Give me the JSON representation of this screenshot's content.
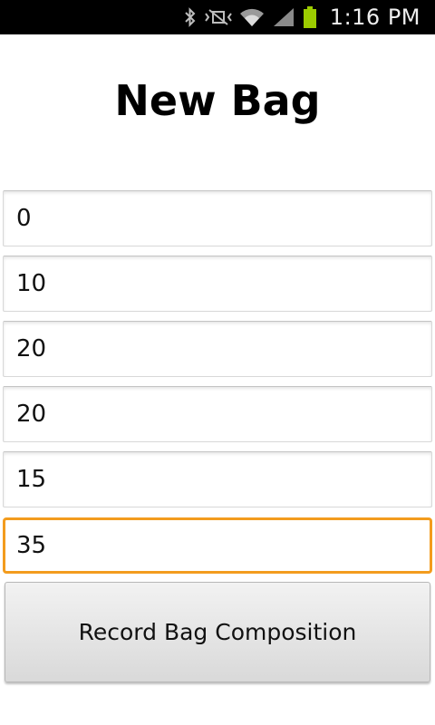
{
  "status_bar": {
    "time": "1:16 PM",
    "icons": [
      "bluetooth-icon",
      "mute-vibrate-icon",
      "wifi-icon",
      "cell-signal-icon",
      "battery-icon"
    ],
    "battery_color": "#9ccc00"
  },
  "screen": {
    "title": "New Bag"
  },
  "fields": [
    {
      "value": "0"
    },
    {
      "value": "10"
    },
    {
      "value": "20"
    },
    {
      "value": "20"
    },
    {
      "value": "15"
    },
    {
      "value": "35",
      "focused": true
    }
  ],
  "focus_color": "#f39c1e",
  "record_button": {
    "label": "Record Bag Composition"
  }
}
